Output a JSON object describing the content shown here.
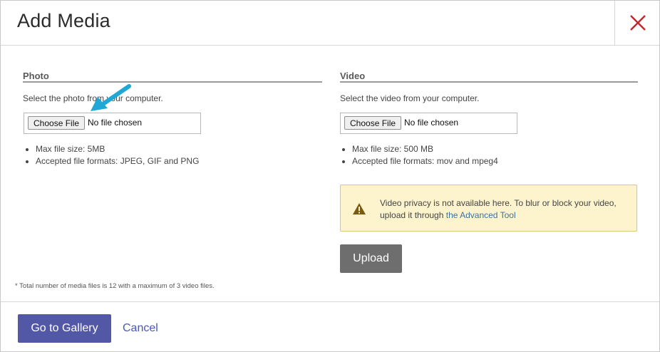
{
  "dialog": {
    "title": "Add Media"
  },
  "photo": {
    "heading": "Photo",
    "hint": "Select the photo from your computer.",
    "choose_label": "Choose File",
    "file_status": "No file chosen",
    "bullets": [
      "Max file size: 5MB",
      "Accepted file formats: JPEG, GIF and PNG"
    ]
  },
  "video": {
    "heading": "Video",
    "hint": "Select the video from your computer.",
    "choose_label": "Choose File",
    "file_status": "No file chosen",
    "bullets": [
      "Max file size: 500 MB",
      "Accepted file formats: mov and mpeg4"
    ],
    "notice_text": "Video privacy is not available here. To blur or block your video, upload it through ",
    "notice_link": "the Advanced Tool",
    "upload_label": "Upload"
  },
  "footnote": "* Total number of media files is 12 with a maximum of 3 video files.",
  "footer": {
    "gallery_label": "Go to Gallery",
    "cancel_label": "Cancel"
  },
  "icons": {
    "close": "close-icon",
    "warning": "warning-icon",
    "pointer": "pointer-arrow-icon"
  },
  "colors": {
    "close": "#c0282d",
    "primary": "#5358a6",
    "upload": "#6e6e6e",
    "notice_bg": "#fdf4cd",
    "arrow": "#1fa7d6"
  }
}
